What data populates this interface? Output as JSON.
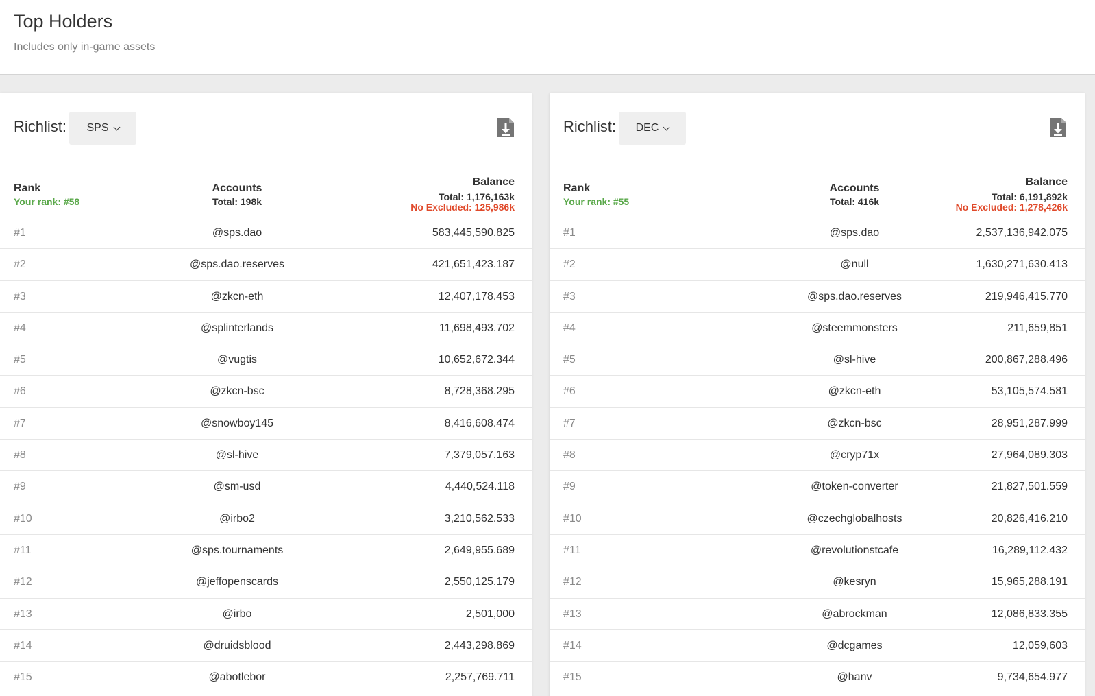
{
  "header": {
    "title": "Top Holders",
    "subtitle": "Includes only in-game assets"
  },
  "panels": [
    {
      "richlist_label": "Richlist:",
      "token": "SPS",
      "columns": {
        "rank": "Rank",
        "your_rank": "Your rank: #58",
        "accounts": "Accounts",
        "accounts_total": "Total: 198k",
        "balance": "Balance",
        "balance_total": "Total: 1,176,163k",
        "balance_no_excluded": "No Excluded: 125,986k"
      },
      "rows": [
        {
          "rank": "#1",
          "account": "@sps.dao",
          "balance": "583,445,590.825"
        },
        {
          "rank": "#2",
          "account": "@sps.dao.reserves",
          "balance": "421,651,423.187"
        },
        {
          "rank": "#3",
          "account": "@zkcn-eth",
          "balance": "12,407,178.453"
        },
        {
          "rank": "#4",
          "account": "@splinterlands",
          "balance": "11,698,493.702"
        },
        {
          "rank": "#5",
          "account": "@vugtis",
          "balance": "10,652,672.344"
        },
        {
          "rank": "#6",
          "account": "@zkcn-bsc",
          "balance": "8,728,368.295"
        },
        {
          "rank": "#7",
          "account": "@snowboy145",
          "balance": "8,416,608.474"
        },
        {
          "rank": "#8",
          "account": "@sl-hive",
          "balance": "7,379,057.163"
        },
        {
          "rank": "#9",
          "account": "@sm-usd",
          "balance": "4,440,524.118"
        },
        {
          "rank": "#10",
          "account": "@irbo2",
          "balance": "3,210,562.533"
        },
        {
          "rank": "#11",
          "account": "@sps.tournaments",
          "balance": "2,649,955.689"
        },
        {
          "rank": "#12",
          "account": "@jeffopenscards",
          "balance": "2,550,125.179"
        },
        {
          "rank": "#13",
          "account": "@irbo",
          "balance": "2,501,000"
        },
        {
          "rank": "#14",
          "account": "@druidsblood",
          "balance": "2,443,298.869"
        },
        {
          "rank": "#15",
          "account": "@abotlebor",
          "balance": "2,257,769.711"
        }
      ]
    },
    {
      "richlist_label": "Richlist:",
      "token": "DEC",
      "columns": {
        "rank": "Rank",
        "your_rank": "Your rank: #55",
        "accounts": "Accounts",
        "accounts_total": "Total: 416k",
        "balance": "Balance",
        "balance_total": "Total: 6,191,892k",
        "balance_no_excluded": "No Excluded: 1,278,426k"
      },
      "rows": [
        {
          "rank": "#1",
          "account": "@sps.dao",
          "balance": "2,537,136,942.075"
        },
        {
          "rank": "#2",
          "account": "@null",
          "balance": "1,630,271,630.413"
        },
        {
          "rank": "#3",
          "account": "@sps.dao.reserves",
          "balance": "219,946,415.770"
        },
        {
          "rank": "#4",
          "account": "@steemmonsters",
          "balance": "211,659,851"
        },
        {
          "rank": "#5",
          "account": "@sl-hive",
          "balance": "200,867,288.496"
        },
        {
          "rank": "#6",
          "account": "@zkcn-eth",
          "balance": "53,105,574.581"
        },
        {
          "rank": "#7",
          "account": "@zkcn-bsc",
          "balance": "28,951,287.999"
        },
        {
          "rank": "#8",
          "account": "@cryp71x",
          "balance": "27,964,089.303"
        },
        {
          "rank": "#9",
          "account": "@token-converter",
          "balance": "21,827,501.559"
        },
        {
          "rank": "#10",
          "account": "@czechglobalhosts",
          "balance": "20,826,416.210"
        },
        {
          "rank": "#11",
          "account": "@revolutionstcafe",
          "balance": "16,289,112.432"
        },
        {
          "rank": "#12",
          "account": "@kesryn",
          "balance": "15,965,288.191"
        },
        {
          "rank": "#13",
          "account": "@abrockman",
          "balance": "12,086,833.355"
        },
        {
          "rank": "#14",
          "account": "@dcgames",
          "balance": "12,059,603"
        },
        {
          "rank": "#15",
          "account": "@hanv",
          "balance": "9,734,654.977"
        }
      ]
    }
  ],
  "icons": {
    "download": "file-download-icon",
    "dropdown": "chevron-down-icon"
  },
  "colors": {
    "your_rank": "#5aa84a",
    "no_excluded": "#e0492a"
  }
}
